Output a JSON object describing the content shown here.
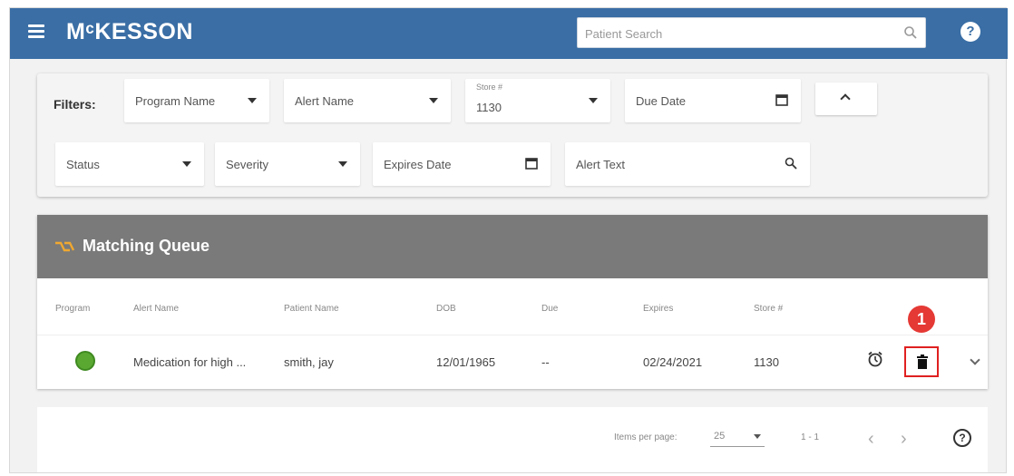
{
  "header": {
    "logo": "MᶜKESSON",
    "search_placeholder": "Patient Search",
    "help": "?"
  },
  "filters": {
    "label": "Filters:",
    "program_name": "Program Name",
    "alert_name": "Alert Name",
    "store_label": "Store #",
    "store_value": "1130",
    "due_date": "Due Date",
    "status": "Status",
    "severity": "Severity",
    "expires_date": "Expires Date",
    "alert_text": "Alert Text"
  },
  "queue": {
    "title": "Matching Queue",
    "columns": [
      "Program",
      "Alert Name",
      "Patient Name",
      "DOB",
      "Due",
      "Expires",
      "Store #"
    ],
    "row": {
      "alert_name": "Medication for high ...",
      "patient_name": "smith, jay",
      "dob": "12/01/1965",
      "due": "--",
      "expires": "02/24/2021",
      "store": "1130"
    },
    "callout": "1"
  },
  "pager": {
    "items_per_page_label": "Items per page:",
    "items_per_page_value": "25",
    "range": "1 - 1",
    "help": "?"
  },
  "colors": {
    "header_blue": "#3a6ea5",
    "queue_header_gray": "#7a7a7a",
    "callout_red": "#e53935",
    "program_green": "#5aa832"
  },
  "icons": [
    "hamburger-icon",
    "search-icon",
    "help-icon",
    "calendar-icon",
    "chevron-up-icon",
    "queue-icon",
    "alarm-icon",
    "trash-icon",
    "chevron-down-icon",
    "chevron-left-icon",
    "chevron-right-icon"
  ]
}
